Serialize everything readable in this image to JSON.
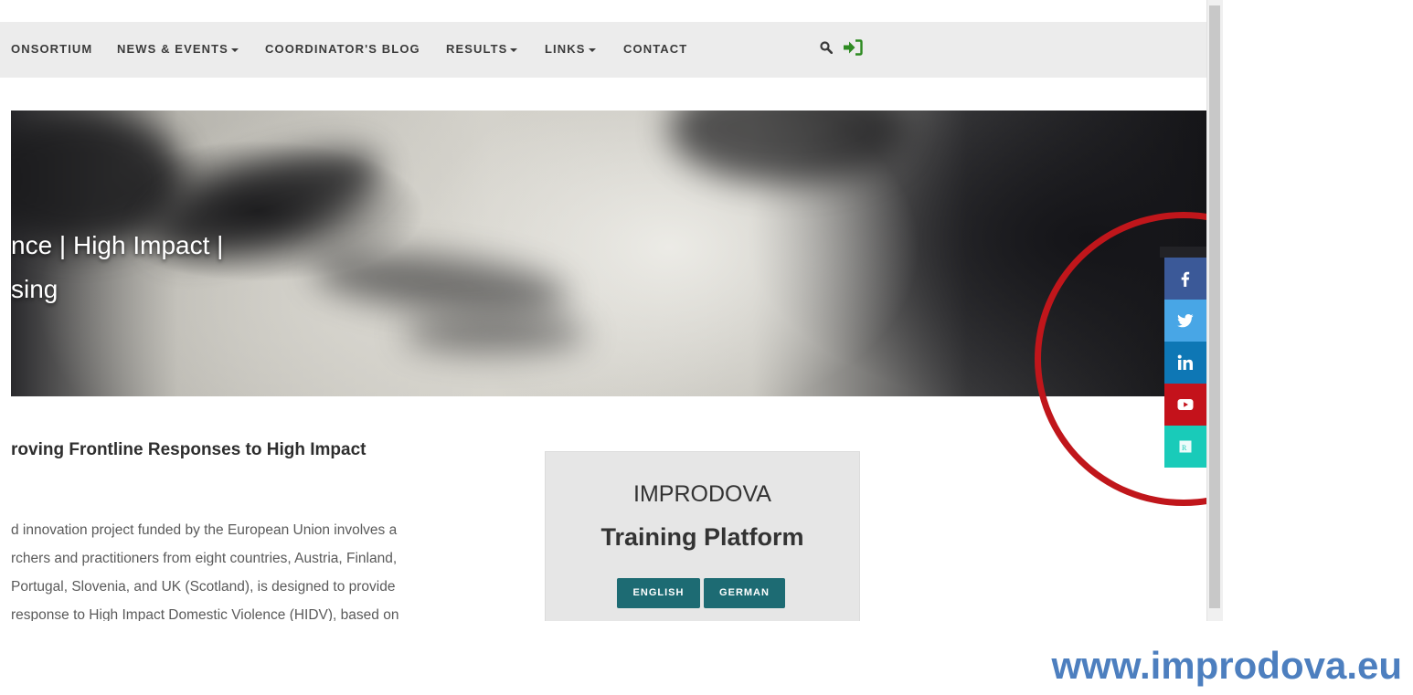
{
  "nav": {
    "items": [
      {
        "label": "ONSORTIUM",
        "dropdown": false
      },
      {
        "label": "NEWS & EVENTS",
        "dropdown": true
      },
      {
        "label": "COORDINATOR'S BLOG",
        "dropdown": false
      },
      {
        "label": "RESULTS",
        "dropdown": true
      },
      {
        "label": "LINKS",
        "dropdown": true
      },
      {
        "label": "CONTACT",
        "dropdown": false
      }
    ],
    "search_icon": "search-icon",
    "login_icon": "sign-in-icon",
    "login_color": "#2e8b22"
  },
  "hero": {
    "line1": "nce | High Impact |",
    "line2": "sing"
  },
  "content": {
    "title": "roving Frontline Responses to High Impact",
    "paragraph_lines": [
      "d innovation project funded by the European Union involves a",
      "rchers and practitioners from eight countries, Austria, Finland,",
      "Portugal, Slovenia, and UK (Scotland), is designed to provide",
      "response to High Impact Domestic Violence (HIDV), based on"
    ]
  },
  "training_box": {
    "title": "IMPRODOVA",
    "subtitle": "Training Platform",
    "buttons": [
      "ENGLISH",
      "GERMAN"
    ],
    "button_color": "#1d6b73"
  },
  "social": [
    {
      "name": "facebook",
      "icon": "facebook-icon",
      "color": "#3b5998"
    },
    {
      "name": "twitter",
      "icon": "twitter-icon",
      "color": "#48a6e6"
    },
    {
      "name": "linkedin",
      "icon": "linkedin-icon",
      "color": "#0e77b5"
    },
    {
      "name": "youtube",
      "icon": "youtube-icon",
      "color": "#c4121b"
    },
    {
      "name": "researchgate",
      "icon": "researchgate-icon",
      "color": "#19cbb9"
    }
  ],
  "highlight_color": "#c0161b",
  "footer": {
    "url": "www.improdova.eu",
    "url_color": "#4d7fbf"
  }
}
